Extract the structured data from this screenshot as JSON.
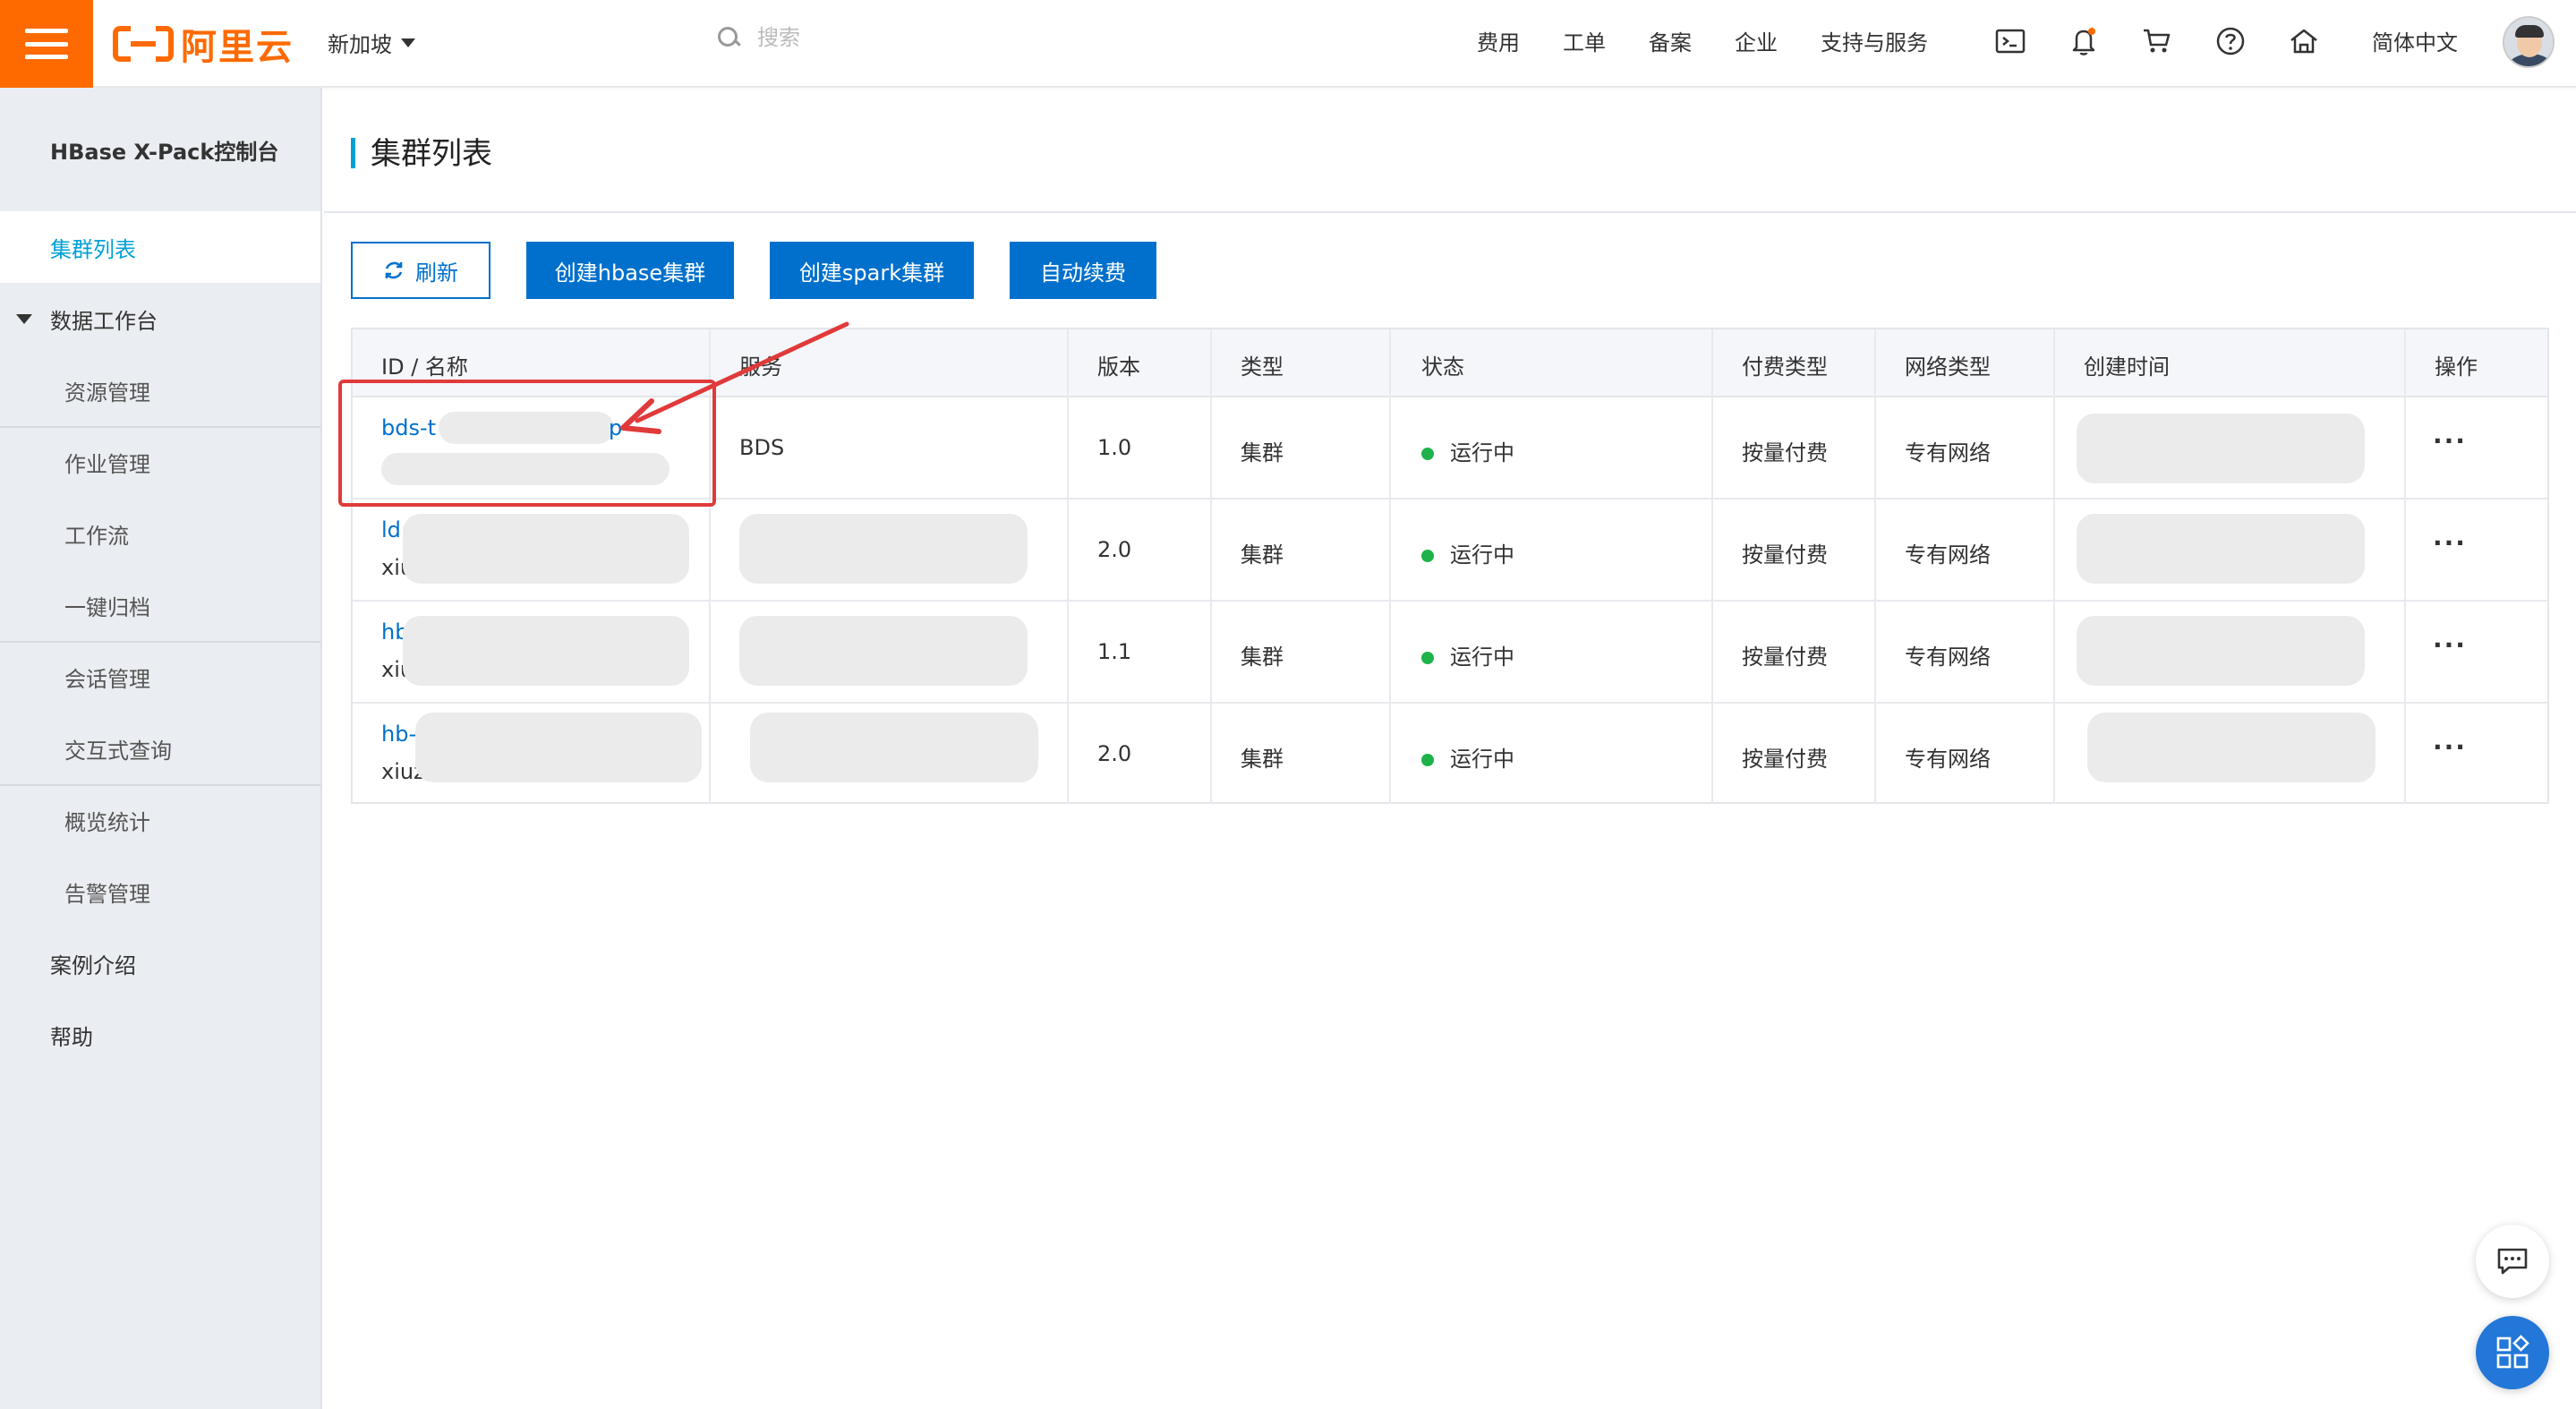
{
  "header": {
    "logo_text": "阿里云",
    "region": "新加坡",
    "search_placeholder": "搜索",
    "links": [
      "费用",
      "工单",
      "备案",
      "企业",
      "支持与服务"
    ],
    "language": "简体中文",
    "accent_color": "#ff6a00"
  },
  "sidebar": {
    "title": "HBase X-Pack控制台",
    "items": {
      "cluster_list": "集群列表",
      "data_workbench": "数据工作台",
      "resource_mgmt": "资源管理",
      "job_mgmt": "作业管理",
      "workflow": "工作流",
      "archive": "一键归档",
      "session_mgmt": "会话管理",
      "interactive_query": "交互式查询",
      "overview_stats": "概览统计",
      "alert_mgmt": "告警管理",
      "case_intro": "案例介绍",
      "help": "帮助"
    }
  },
  "page": {
    "title": "集群列表",
    "buttons": {
      "refresh": "刷新",
      "create_hbase": "创建hbase集群",
      "create_spark": "创建spark集群",
      "auto_renew": "自动续费"
    }
  },
  "table": {
    "headers": {
      "id_name": "ID / 名称",
      "service": "服务",
      "version": "版本",
      "type": "类型",
      "status": "状态",
      "pay_type": "付费类型",
      "network_type": "网络类型",
      "created": "创建时间",
      "actions": "操作"
    },
    "rows": [
      {
        "id": "bds-t",
        "id_suffix": "p",
        "name": "",
        "service": "BDS",
        "version": "1.0",
        "type": "集群",
        "status": "运行中",
        "pay_type": "按量付费",
        "network": "专有网络",
        "actions": "···"
      },
      {
        "id": "ld",
        "name": "xiu",
        "service": "",
        "version": "2.0",
        "type": "集群",
        "status": "运行中",
        "pay_type": "按量付费",
        "network": "专有网络",
        "actions": "···"
      },
      {
        "id": "hb",
        "name": "xiu",
        "service": "",
        "version": "1.1",
        "type": "集群",
        "status": "运行中",
        "pay_type": "按量付费",
        "network": "专有网络",
        "actions": "···"
      },
      {
        "id": "hb-",
        "name": "xiuz",
        "service": "",
        "version": "2.0",
        "type": "集群",
        "status": "运行中",
        "pay_type": "按量付费",
        "network": "专有网络",
        "actions": "···"
      }
    ]
  },
  "colors": {
    "primary": "#0070cc",
    "active_nav": "#00a1d6",
    "status_running": "#1eb34a",
    "annotation": "#e03a3a"
  }
}
